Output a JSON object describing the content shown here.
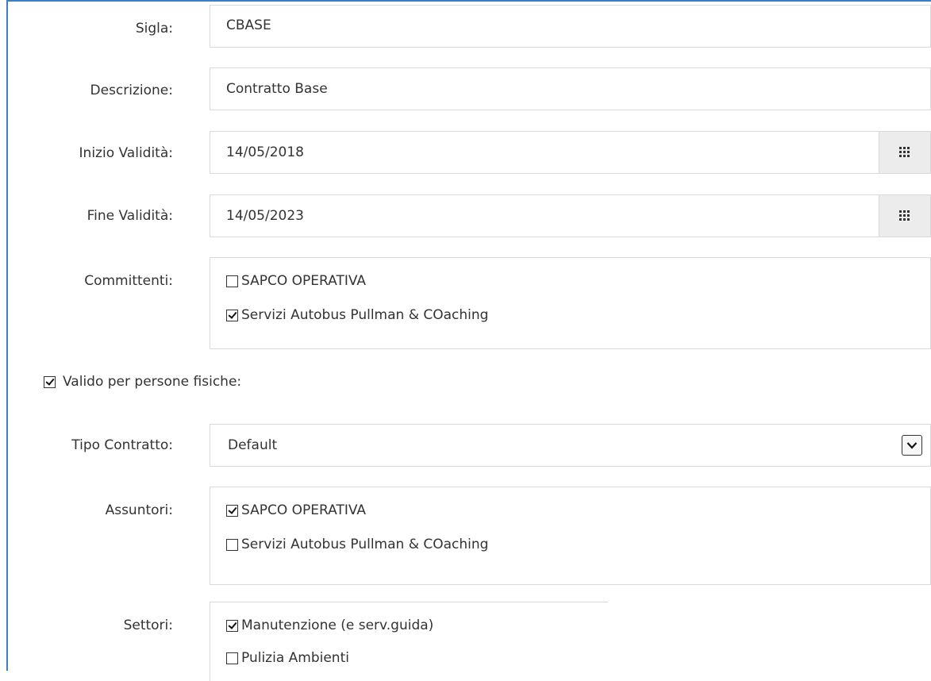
{
  "form": {
    "sigla": {
      "label": "Sigla:",
      "value": "CBASE"
    },
    "descrizione": {
      "label": "Descrizione:",
      "value": "Contratto Base"
    },
    "inizio": {
      "label": "Inizio Validità:",
      "value": "14/05/2018",
      "icon": "calendar-grid-icon"
    },
    "fine": {
      "label": "Fine Validità:",
      "value": "14/05/2023",
      "icon": "calendar-grid-icon"
    },
    "committenti": {
      "label": "Committenti:",
      "options": [
        {
          "label": "SAPCO OPERATIVA",
          "checked": false
        },
        {
          "label": "Servizi Autobus Pullman & COaching",
          "checked": true
        }
      ]
    },
    "persone_fisiche": {
      "label": "Valido per persone fisiche:",
      "checked": true
    },
    "tipo_contratto": {
      "label": "Tipo Contratto:",
      "value": "Default",
      "icon": "chevron-down-icon"
    },
    "assuntori": {
      "label": "Assuntori:",
      "options": [
        {
          "label": "SAPCO OPERATIVA",
          "checked": true
        },
        {
          "label": "Servizi Autobus Pullman & COaching",
          "checked": false
        }
      ]
    },
    "settori": {
      "label": "Settori:",
      "options": [
        {
          "label": "Manutenzione (e serv.guida)",
          "checked": true
        },
        {
          "label": "Pulizia Ambienti",
          "checked": false
        }
      ]
    }
  }
}
